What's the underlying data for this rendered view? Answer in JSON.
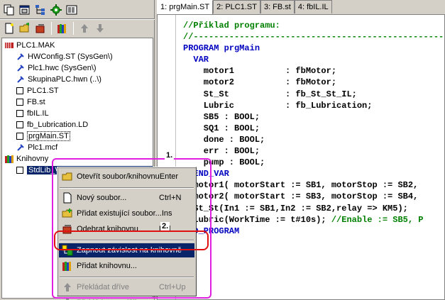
{
  "toolbar_icons": [
    "copy-files-icon",
    "window-icon",
    "tree-icon",
    "settings-gear-icon",
    "library-icon"
  ],
  "toolbar2_icons": [
    "new-file-icon",
    "open-folder-icon",
    "export-icon",
    "books-icon",
    "arrow-up-icon",
    "arrow-down-icon"
  ],
  "tree": {
    "root": "PLC1.MAK",
    "items": [
      {
        "label": "HWConfig.ST   (SysGen\\)",
        "icon": "pin-icon"
      },
      {
        "label": "Plc1.hwc   (SysGen\\)",
        "icon": "pin-icon"
      },
      {
        "label": "SkupinaPLC.hwn   (..\\)",
        "icon": "pin-icon"
      },
      {
        "label": "PLC1.ST",
        "icon": "file-icon"
      },
      {
        "label": "FB.st",
        "icon": "file-icon"
      },
      {
        "label": "fbIL.IL",
        "icon": "file-icon"
      },
      {
        "label": "fb_Lubrication.LD",
        "icon": "file-icon"
      },
      {
        "label": "prgMain.ST",
        "icon": "file-icon"
      },
      {
        "label": "Plc1.mcf",
        "icon": "pin-icon"
      }
    ],
    "libraries_label": "Knihovny",
    "library_item": "StdLib_V18_20090401.mlb   (SysLib\\)"
  },
  "tabs": [
    "1: prgMain.ST",
    "2: PLC1.ST",
    "3: FB.st",
    "4: fbIL.IL"
  ],
  "code_lines": [
    {
      "t": "//Příklad programu:",
      "c": "cmt"
    },
    {
      "t": "//-------------------------------------------------",
      "c": "cmt"
    },
    {
      "t": "PROGRAM prgMain",
      "c": "kw"
    },
    {
      "t": "  VAR",
      "c": "kw"
    },
    {
      "t": "    motor1          : fbMotor;",
      "c": "tx"
    },
    {
      "t": "    motor2          : fbMotor;",
      "c": "tx"
    },
    {
      "t": "    St_St           : fb_St_St_IL;",
      "c": "tx"
    },
    {
      "t": "    Lubric          : fb_Lubrication;",
      "c": "tx"
    },
    {
      "t": "    SB5 : BOOL;",
      "c": "tx"
    },
    {
      "t": "    SQ1 : BOOL;",
      "c": "tx"
    },
    {
      "t": "    done : BOOL;",
      "c": "tx"
    },
    {
      "t": "    err : BOOL;",
      "c": "tx"
    },
    {
      "t": "    pump : BOOL;",
      "c": "tx"
    },
    {
      "t": "  END_VAR",
      "c": "kw"
    },
    {
      "t": "  motor1( motorStart := SB1, motorStop := SB2,",
      "c": "tx"
    },
    {
      "t": "  motor2( motorStart := SB3, motorStop := SB4,",
      "c": "tx"
    },
    {
      "t": "  St_St(In1 := SB1,In2 := SB2,relay => KM5);",
      "c": "tx"
    },
    {
      "t": "  Lubric(WorkTime := t#10s); //Enable := SB5, P",
      "c": "mix"
    },
    {
      "t": "END_PROGRAM",
      "c": "kw"
    }
  ],
  "menu": {
    "items": [
      {
        "label": "Otevřít soubor/knihovnu",
        "shortcut": "Enter",
        "icon": "open-folder-icon",
        "state": "normal"
      },
      {
        "sep": true
      },
      {
        "label": "Nový soubor...",
        "shortcut": "Ctrl+N",
        "icon": "new-file-icon",
        "state": "normal"
      },
      {
        "label": "Přidat existující soubor...",
        "shortcut": "Ins",
        "icon": "add-file-icon",
        "state": "normal"
      },
      {
        "label": "Odebrat knihovnu",
        "shortcut": "Del",
        "icon": "remove-library-icon",
        "state": "normal"
      },
      {
        "sep": true
      },
      {
        "label": "Zapnout závislost na knihovně",
        "shortcut": "",
        "icon": "dependency-icon",
        "state": "highlight"
      },
      {
        "label": "Přidat knihovnu...",
        "shortcut": "",
        "icon": "books-icon",
        "state": "normal"
      },
      {
        "sep": true
      },
      {
        "label": "Překládat dříve",
        "shortcut": "Ctrl+Up",
        "icon": "arrow-up-icon",
        "state": "disabled"
      },
      {
        "label": "Překládat později",
        "shortcut": "Ctrl+Down",
        "icon": "arrow-down-icon",
        "state": "disabled"
      }
    ]
  },
  "annotations": {
    "step1": "1.",
    "step2": "2."
  },
  "colors": {
    "selection": "#0a246a",
    "annotation_box": "#e020e0",
    "annotation_highlight": "#e01010",
    "comment": "#008000",
    "keyword": "#0000c0"
  }
}
